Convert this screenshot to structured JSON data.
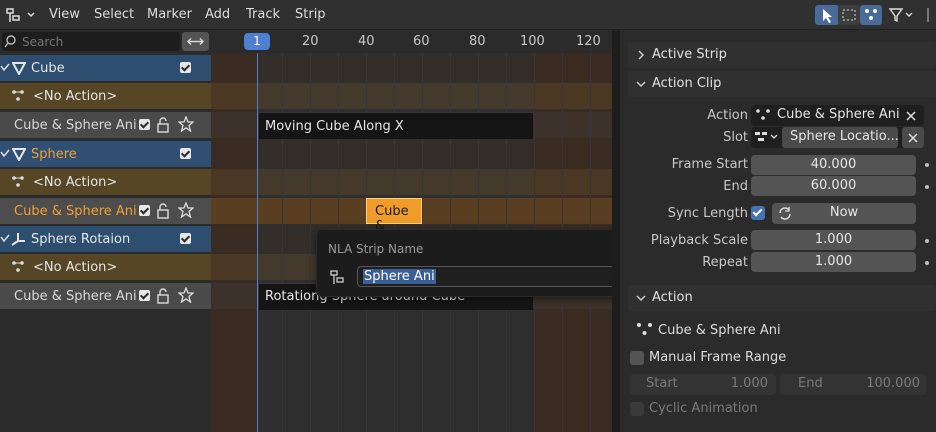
{
  "header": {
    "menus": [
      "View",
      "Select",
      "Marker",
      "Add",
      "Track",
      "Strip"
    ]
  },
  "search": {
    "placeholder": "Search"
  },
  "timeline": {
    "current_frame": "1",
    "ticks": [
      "20",
      "40",
      "60",
      "80",
      "100",
      "120"
    ]
  },
  "tracks": [
    {
      "type": "object",
      "label": "Cube",
      "icon": "mesh-triangle-icon"
    },
    {
      "type": "action",
      "label": "<No Action>"
    },
    {
      "type": "strip_track",
      "label": "Cube & Sphere Ani"
    },
    {
      "type": "object",
      "label": "Sphere",
      "icon": "mesh-triangle-icon",
      "selected": true
    },
    {
      "type": "action",
      "label": "<No Action>"
    },
    {
      "type": "strip_track",
      "label": "Cube & Sphere Ani",
      "selected": true
    },
    {
      "type": "object",
      "label": "Sphere Rotaion",
      "icon": "empty-axes-icon"
    },
    {
      "type": "action",
      "label": "<No Action>"
    },
    {
      "type": "strip_track",
      "label": "Cube & Sphere Ani"
    }
  ],
  "strips": {
    "cube": "Moving Cube Along X",
    "sphere": "Cube &",
    "rotation": "Rotationg Sphere around Cube"
  },
  "popup": {
    "title": "NLA Strip Name",
    "value": "Sphere Ani"
  },
  "panel": {
    "active_strip": "Active Strip",
    "action_clip": {
      "title": "Action Clip",
      "action_label": "Action",
      "action_value": "Cube & Sphere Ani",
      "slot_label": "Slot",
      "slot_value": "Sphere Locatio...",
      "frame_start_label": "Frame Start",
      "frame_start": "40.000",
      "end_label": "End",
      "end": "60.000",
      "sync_label": "Sync Length",
      "now_label": "Now",
      "playback_scale_label": "Playback Scale",
      "playback_scale": "1.000",
      "repeat_label": "Repeat",
      "repeat": "1.000"
    },
    "action": {
      "title": "Action",
      "name": "Cube & Sphere Ani",
      "manual_range": "Manual Frame Range",
      "start_label": "Start",
      "start": "1.000",
      "end_label": "End",
      "end": "100.000",
      "cyclic": "Cyclic Animation"
    }
  },
  "colors": {
    "accent": "#f0a030",
    "selected_track": "#314f73",
    "action_row": "#574626",
    "frame_line": "#4f7fd0"
  }
}
